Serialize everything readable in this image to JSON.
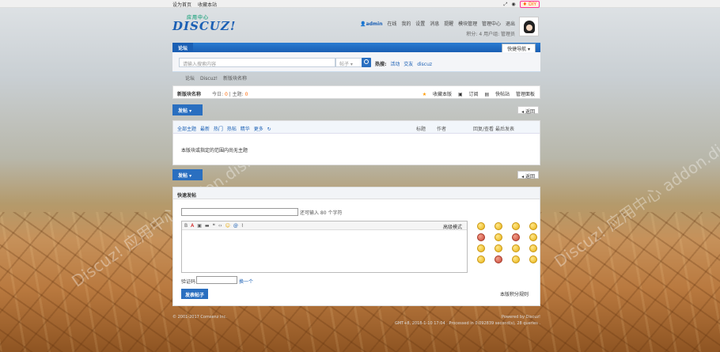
{
  "topbar": {
    "set_home": "设为首页",
    "bookmark": "收藏本站",
    "diy": "DIY"
  },
  "logo": {
    "text": "DISCUZ!",
    "sub": "应用中心"
  },
  "user": {
    "name": "admin",
    "status": "在线",
    "links": [
      "我的",
      "设置",
      "消息",
      "提醒",
      "模块管理",
      "管理中心",
      "退出"
    ],
    "points_label": "积分: 4",
    "group_label": "用户组: 管理员"
  },
  "nav": {
    "tab": "论坛",
    "quick": "快捷导航"
  },
  "search": {
    "placeholder": "请输入搜索内容",
    "type": "帖子",
    "hot_label": "热搜:",
    "hot": [
      "活动",
      "交友",
      "discuz"
    ]
  },
  "breadcrumb": [
    "论坛",
    "Discuz!",
    "新版块名称"
  ],
  "forum": {
    "title": "新版块名称",
    "today_label": "今日:",
    "today": "0",
    "topics_label": "主题:",
    "topics": "0",
    "actions": [
      "收藏本版",
      "订阅",
      "快帖站",
      "管理面板"
    ]
  },
  "buttons": {
    "post": "发帖",
    "back": "返回"
  },
  "threadlist": {
    "filters": [
      "全部主题",
      "最新",
      "热门",
      "热帖",
      "精华",
      "更多"
    ],
    "col_title": "标题",
    "col_author": "作者",
    "col_replies": "回复/查看",
    "col_last": "最后发表",
    "empty": "本版块或指定的范围内尚无主题"
  },
  "fastpost": {
    "title": "快速发帖",
    "subject_hint": "还可输入 80 个字符",
    "advanced": "高级模式",
    "captcha_label": "验证码",
    "captcha_change": "换一个",
    "submit": "发表帖子",
    "rules": "本版积分规则"
  },
  "footer": {
    "copyright": "© 2001-2017 Comsenz Inc.",
    "power": "Powered by Discuz!",
    "stat": "GMT+8, 2018-1-10 17:04 , Processed in 0.092839 second(s), 28 queries ."
  },
  "watermark": "Discuz! 应用中心 addon.dismall.com"
}
